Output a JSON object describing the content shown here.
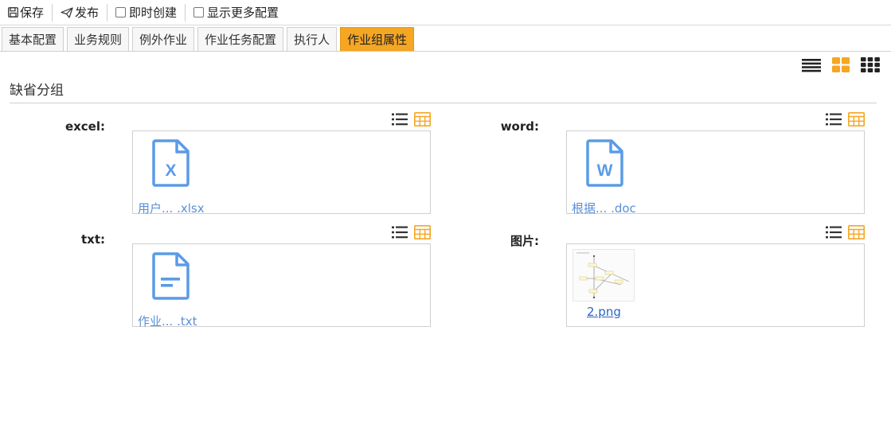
{
  "toolbar": {
    "save_label": "保存",
    "publish_label": "发布",
    "instant_create_label": "即时创建",
    "show_more_label": "显示更多配置"
  },
  "tabs": [
    {
      "label": "基本配置",
      "active": false
    },
    {
      "label": "业务规则",
      "active": false
    },
    {
      "label": "例外作业",
      "active": false
    },
    {
      "label": "作业任务配置",
      "active": false
    },
    {
      "label": "执行人",
      "active": false
    },
    {
      "label": "作业组属性",
      "active": true
    }
  ],
  "colors": {
    "accent": "#f5a623",
    "file_icon": "#5b9be6",
    "file_link": "#5b8fd6",
    "image_link": "#2b63c5"
  },
  "group": {
    "title": "缺省分组",
    "fields": [
      {
        "label": "excel:",
        "file_name": "用户...  .xlsx",
        "icon": "excel-file-icon",
        "icon_letter": "X"
      },
      {
        "label": "word:",
        "file_name": "根据...  .doc",
        "icon": "word-file-icon",
        "icon_letter": "W"
      },
      {
        "label": "txt:",
        "file_name": "作业...    .txt",
        "icon": "text-file-icon",
        "icon_letter": ""
      },
      {
        "label": "图片:",
        "file_name": "2.png",
        "icon": "image-thumbnail",
        "icon_letter": ""
      }
    ]
  }
}
